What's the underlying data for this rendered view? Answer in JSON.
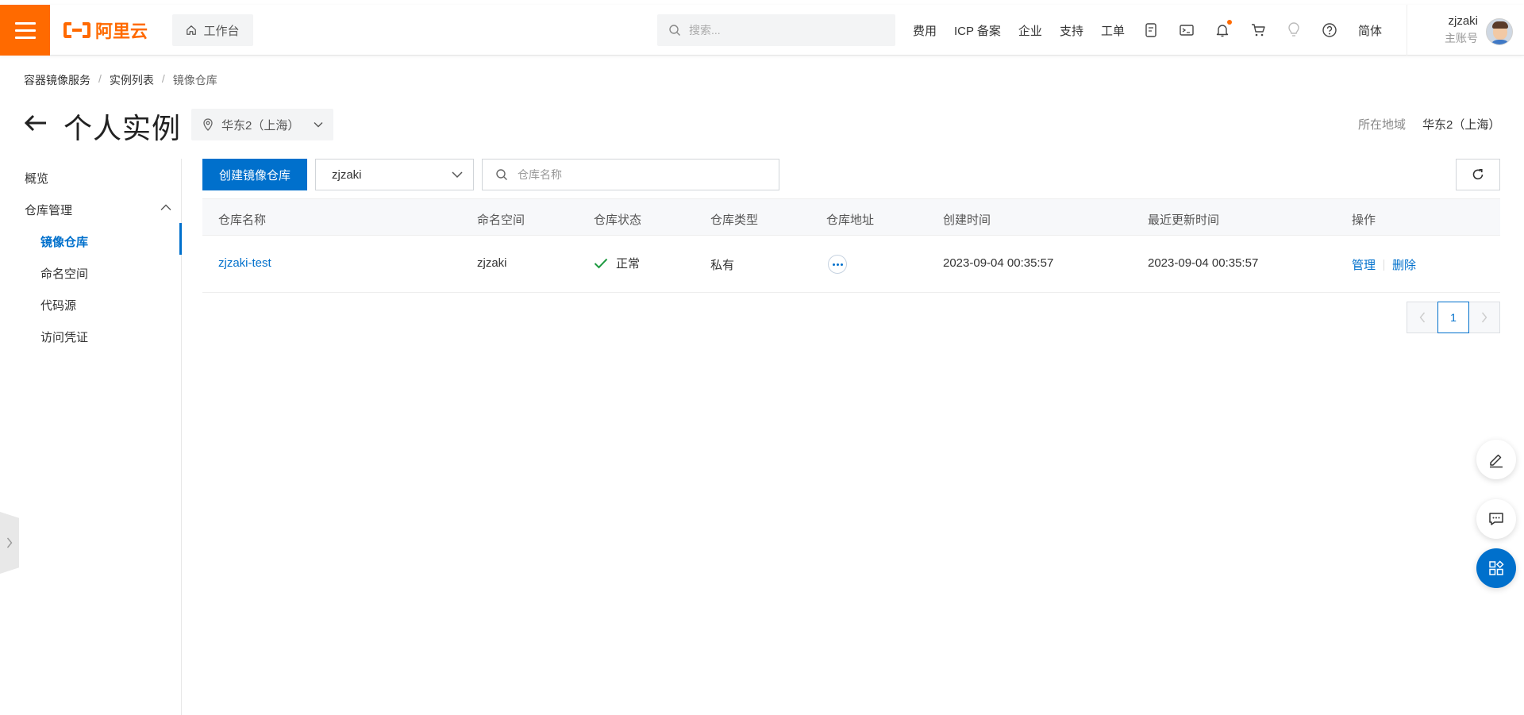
{
  "topbar": {
    "logo_text": "阿里云",
    "workbench_label": "工作台",
    "search_placeholder": "搜索...",
    "nav": [
      "费用",
      "ICP 备案",
      "企业",
      "支持",
      "工单"
    ],
    "lang": "简体",
    "account_name": "zjzaki",
    "account_role": "主账号",
    "accent_color": "#ff6a00"
  },
  "breadcrumb": [
    "容器镜像服务",
    "实例列表",
    "镜像仓库"
  ],
  "page": {
    "title": "个人实例",
    "region_selected": "华东2（上海）",
    "region_label": "所在地域",
    "region_value": "华东2（上海）"
  },
  "sidebar": {
    "overview": "概览",
    "group": "仓库管理",
    "items": [
      "镜像仓库",
      "命名空间",
      "代码源",
      "访问凭证"
    ],
    "active_index": 0
  },
  "toolbar": {
    "create_label": "创建镜像仓库",
    "namespace_value": "zjzaki",
    "repo_search_placeholder": "仓库名称"
  },
  "table": {
    "headers": [
      "仓库名称",
      "命名空间",
      "仓库状态",
      "仓库类型",
      "仓库地址",
      "创建时间",
      "最近更新时间",
      "操作"
    ],
    "rows": [
      {
        "name": "zjzaki-test",
        "namespace": "zjzaki",
        "status": "正常",
        "type": "私有",
        "created": "2023-09-04 00:35:57",
        "updated": "2023-09-04 00:35:57",
        "op_manage": "管理",
        "op_delete": "删除"
      }
    ]
  },
  "pagination": {
    "current": "1"
  },
  "colors": {
    "primary": "#0070cc",
    "success": "#1e9a41"
  }
}
